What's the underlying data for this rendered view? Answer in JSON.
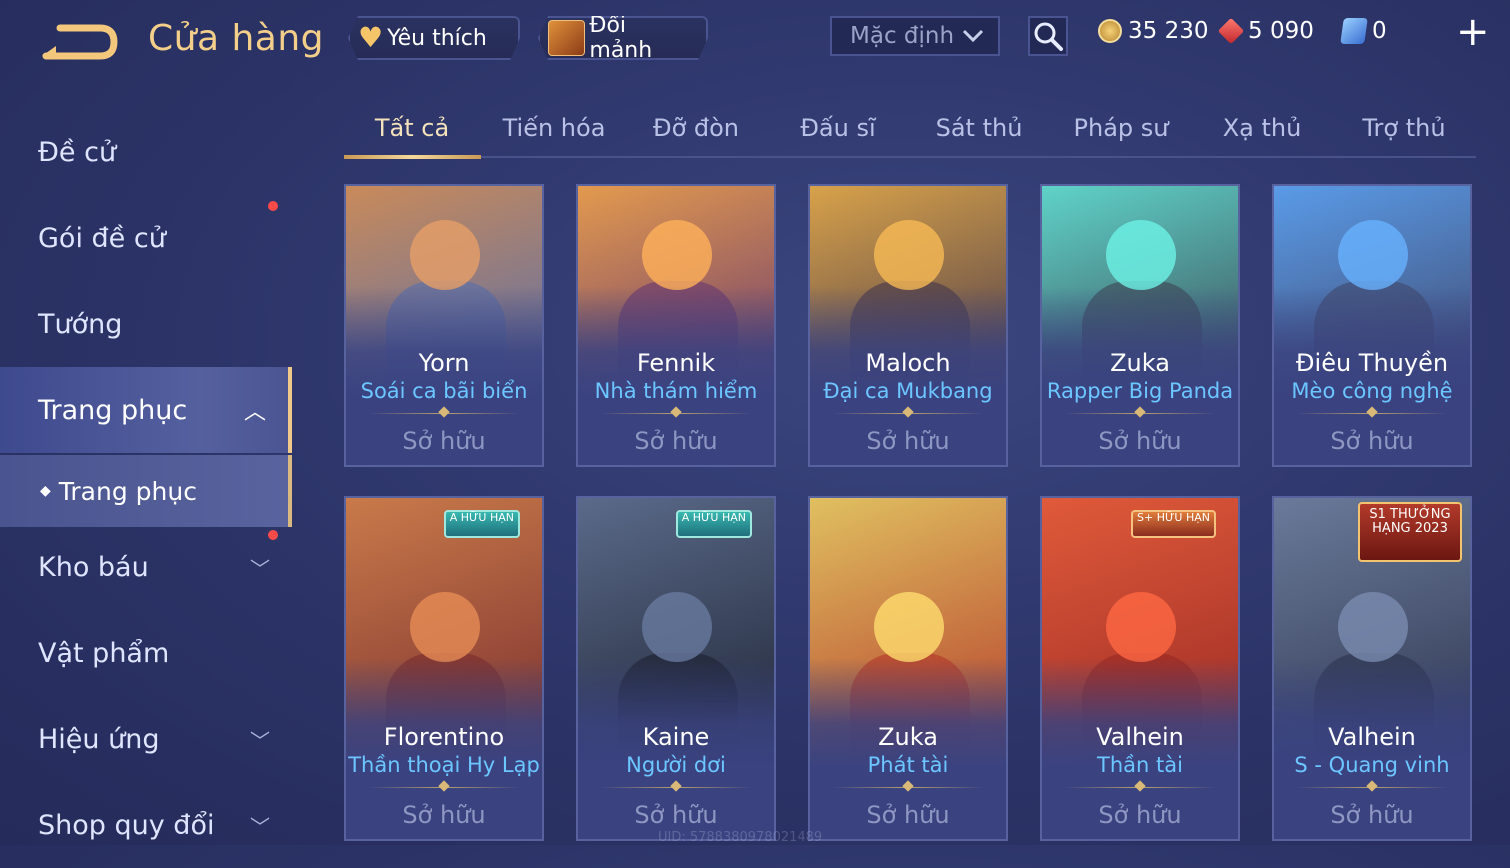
{
  "header": {
    "title": "Cửa hàng",
    "favorites_label": "Yêu thích",
    "exchange_label": "Đổi mảnh",
    "sort_value": "Mặc định",
    "currencies": {
      "gold": "35 230",
      "ruby": "5 090",
      "voucher": "0"
    }
  },
  "sidebar": {
    "items": [
      {
        "label": "Đề cử"
      },
      {
        "label": "Gói đề cử"
      },
      {
        "label": "Tướng"
      },
      {
        "label": "Trang phục"
      },
      {
        "label": "Kho báu"
      },
      {
        "label": "Vật phẩm"
      },
      {
        "label": "Hiệu ứng"
      },
      {
        "label": "Shop quy đổi"
      }
    ],
    "sub_item": "Trang phục"
  },
  "tabs": [
    "Tất cả",
    "Tiến hóa",
    "Đỡ đòn",
    "Đấu sĩ",
    "Sát thủ",
    "Pháp sư",
    "Xạ thủ",
    "Trợ thủ"
  ],
  "cards": [
    {
      "hero": "Yorn",
      "skin": "Soái ca bãi biển",
      "status": "Sở hữu",
      "colors": [
        "#c98a5a",
        "#5b6fa8"
      ]
    },
    {
      "hero": "Fennik",
      "skin": "Nhà thám hiểm",
      "status": "Sở hữu",
      "colors": [
        "#e39a4e",
        "#6b3a6f"
      ]
    },
    {
      "hero": "Maloch",
      "skin": "Đại ca Mukbang",
      "status": "Sở hữu",
      "colors": [
        "#d8a24a",
        "#4a3a4a"
      ]
    },
    {
      "hero": "Zuka",
      "skin": "Rapper Big Panda",
      "status": "Sở hữu",
      "colors": [
        "#5fd3c8",
        "#3d4a58"
      ]
    },
    {
      "hero": "Điêu Thuyền",
      "skin": "Mèo công nghệ",
      "status": "Sở hữu",
      "colors": [
        "#5a9be8",
        "#40496e"
      ]
    },
    {
      "hero": "Florentino",
      "skin": "Thần thoại Hy Lạp",
      "status": "Sở hữu",
      "badge": "A HỮU HẠN",
      "colors": [
        "#c97a4a",
        "#7a2e2e"
      ]
    },
    {
      "hero": "Kaine",
      "skin": "Người dơi",
      "status": "Sở hữu",
      "badge": "A HỮU HẠN",
      "colors": [
        "#5a6a8a",
        "#1f2434"
      ]
    },
    {
      "hero": "Zuka",
      "skin": "Phát tài",
      "status": "Sở hữu",
      "colors": [
        "#e0c060",
        "#b43a2a"
      ]
    },
    {
      "hero": "Valhein",
      "skin": "Thần tài",
      "status": "Sở hữu",
      "badge": "S+ HỮU HẠN",
      "colors": [
        "#e05a3a",
        "#9a2a24"
      ]
    },
    {
      "hero": "Valhein",
      "skin": "S - Quang vinh",
      "status": "Sở hữu",
      "badge": "S1 THƯỞNG HẠNG 2023",
      "colors": [
        "#6a7a9a",
        "#2e3650"
      ]
    }
  ]
}
